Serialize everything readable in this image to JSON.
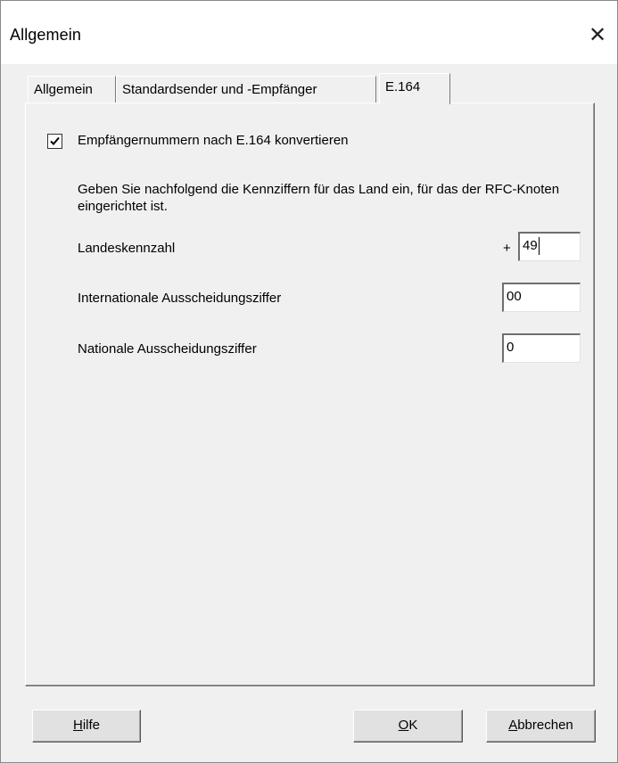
{
  "window": {
    "title": "Allgemein",
    "close_glyph": "✕"
  },
  "tabs": [
    {
      "label": "Allgemein",
      "active": false
    },
    {
      "label": "Standardsender und -Empfänger",
      "active": false
    },
    {
      "label": "E.164",
      "active": true
    }
  ],
  "e164": {
    "checkbox_label": "Empfängernummern nach E.164 konvertieren",
    "checkbox_checked": true,
    "description": "Geben Sie nachfolgend die Kennziffern für das Land ein, für das der RFC-Knoten eingerichtet ist.",
    "country_code": {
      "label": "Landeskennzahl",
      "prefix": "+",
      "value": "49"
    },
    "international_prefix": {
      "label": "Internationale Ausscheidungsziffer",
      "value": "00"
    },
    "national_prefix": {
      "label": "Nationale Ausscheidungsziffer",
      "value": "0"
    }
  },
  "buttons": {
    "help": {
      "mnemonic": "H",
      "rest": "ilfe"
    },
    "ok": {
      "mnemonic": "O",
      "rest": "K"
    },
    "cancel": {
      "mnemonic": "A",
      "rest": "bbrechen"
    }
  }
}
